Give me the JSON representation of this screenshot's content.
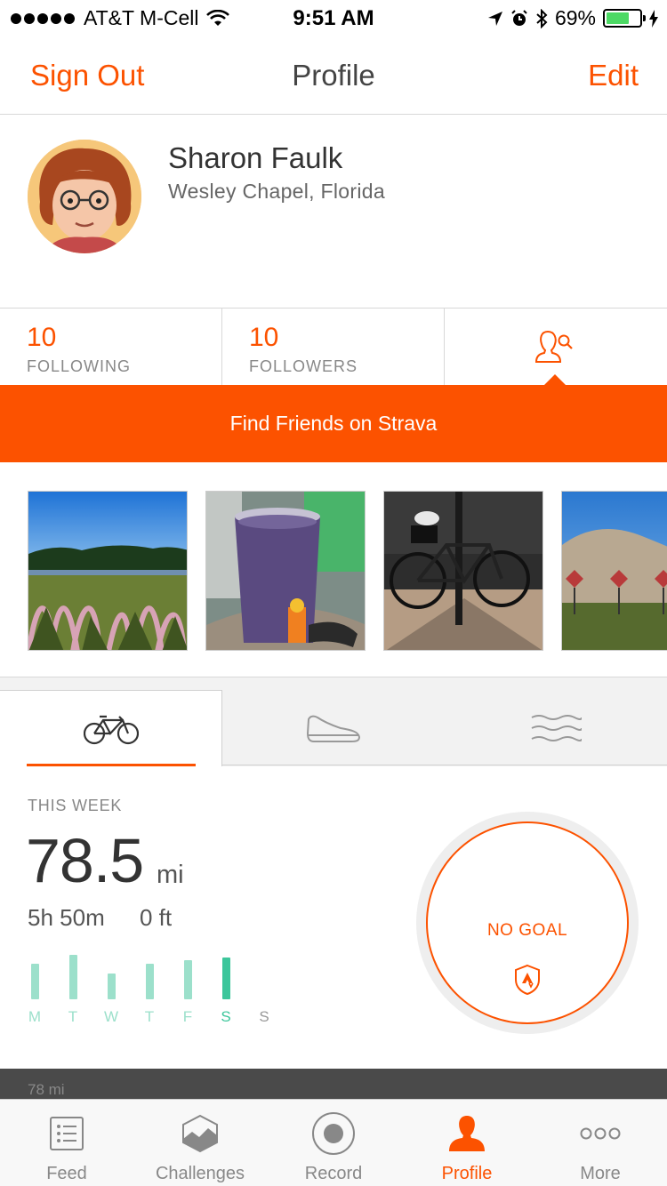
{
  "status_bar": {
    "carrier": "AT&T M-Cell",
    "time": "9:51 AM",
    "battery": "69%",
    "battery_level": 0.69
  },
  "nav": {
    "left": "Sign Out",
    "title": "Profile",
    "right": "Edit"
  },
  "profile": {
    "name": "Sharon Faulk",
    "location": "Wesley Chapel, Florida"
  },
  "stats": {
    "following_count": "10",
    "following_label": "FOLLOWING",
    "followers_count": "10",
    "followers_label": "FOLLOWERS",
    "find_icon": "find-friends-icon"
  },
  "banner": "Find Friends on Strava",
  "photos": [
    "photo-park",
    "photo-smoothie",
    "photo-bicycle",
    "photo-dirt-mound"
  ],
  "sport_tabs": [
    "bike-icon",
    "shoe-icon",
    "swim-icon"
  ],
  "week": {
    "label": "THIS WEEK",
    "distance": "78.5",
    "unit": "mi",
    "time": "5h 50m",
    "elevation": "0 ft",
    "days": [
      "M",
      "T",
      "W",
      "T",
      "F",
      "S",
      "S"
    ],
    "day_levels": [
      0.8,
      1.0,
      0.58,
      0.8,
      0.88,
      0.94,
      0
    ],
    "goal": "NO GOAL"
  },
  "strip_label": "78 mi",
  "tab_bar": [
    {
      "label": "Feed",
      "icon": "feed-icon"
    },
    {
      "label": "Challenges",
      "icon": "challenges-icon"
    },
    {
      "label": "Record",
      "icon": "record-icon"
    },
    {
      "label": "Profile",
      "icon": "profile-icon"
    },
    {
      "label": "More",
      "icon": "more-icon"
    }
  ],
  "colors": {
    "accent": "#fc5200",
    "bar": "#9ce0cb",
    "bar_today": "#3cc69b"
  }
}
